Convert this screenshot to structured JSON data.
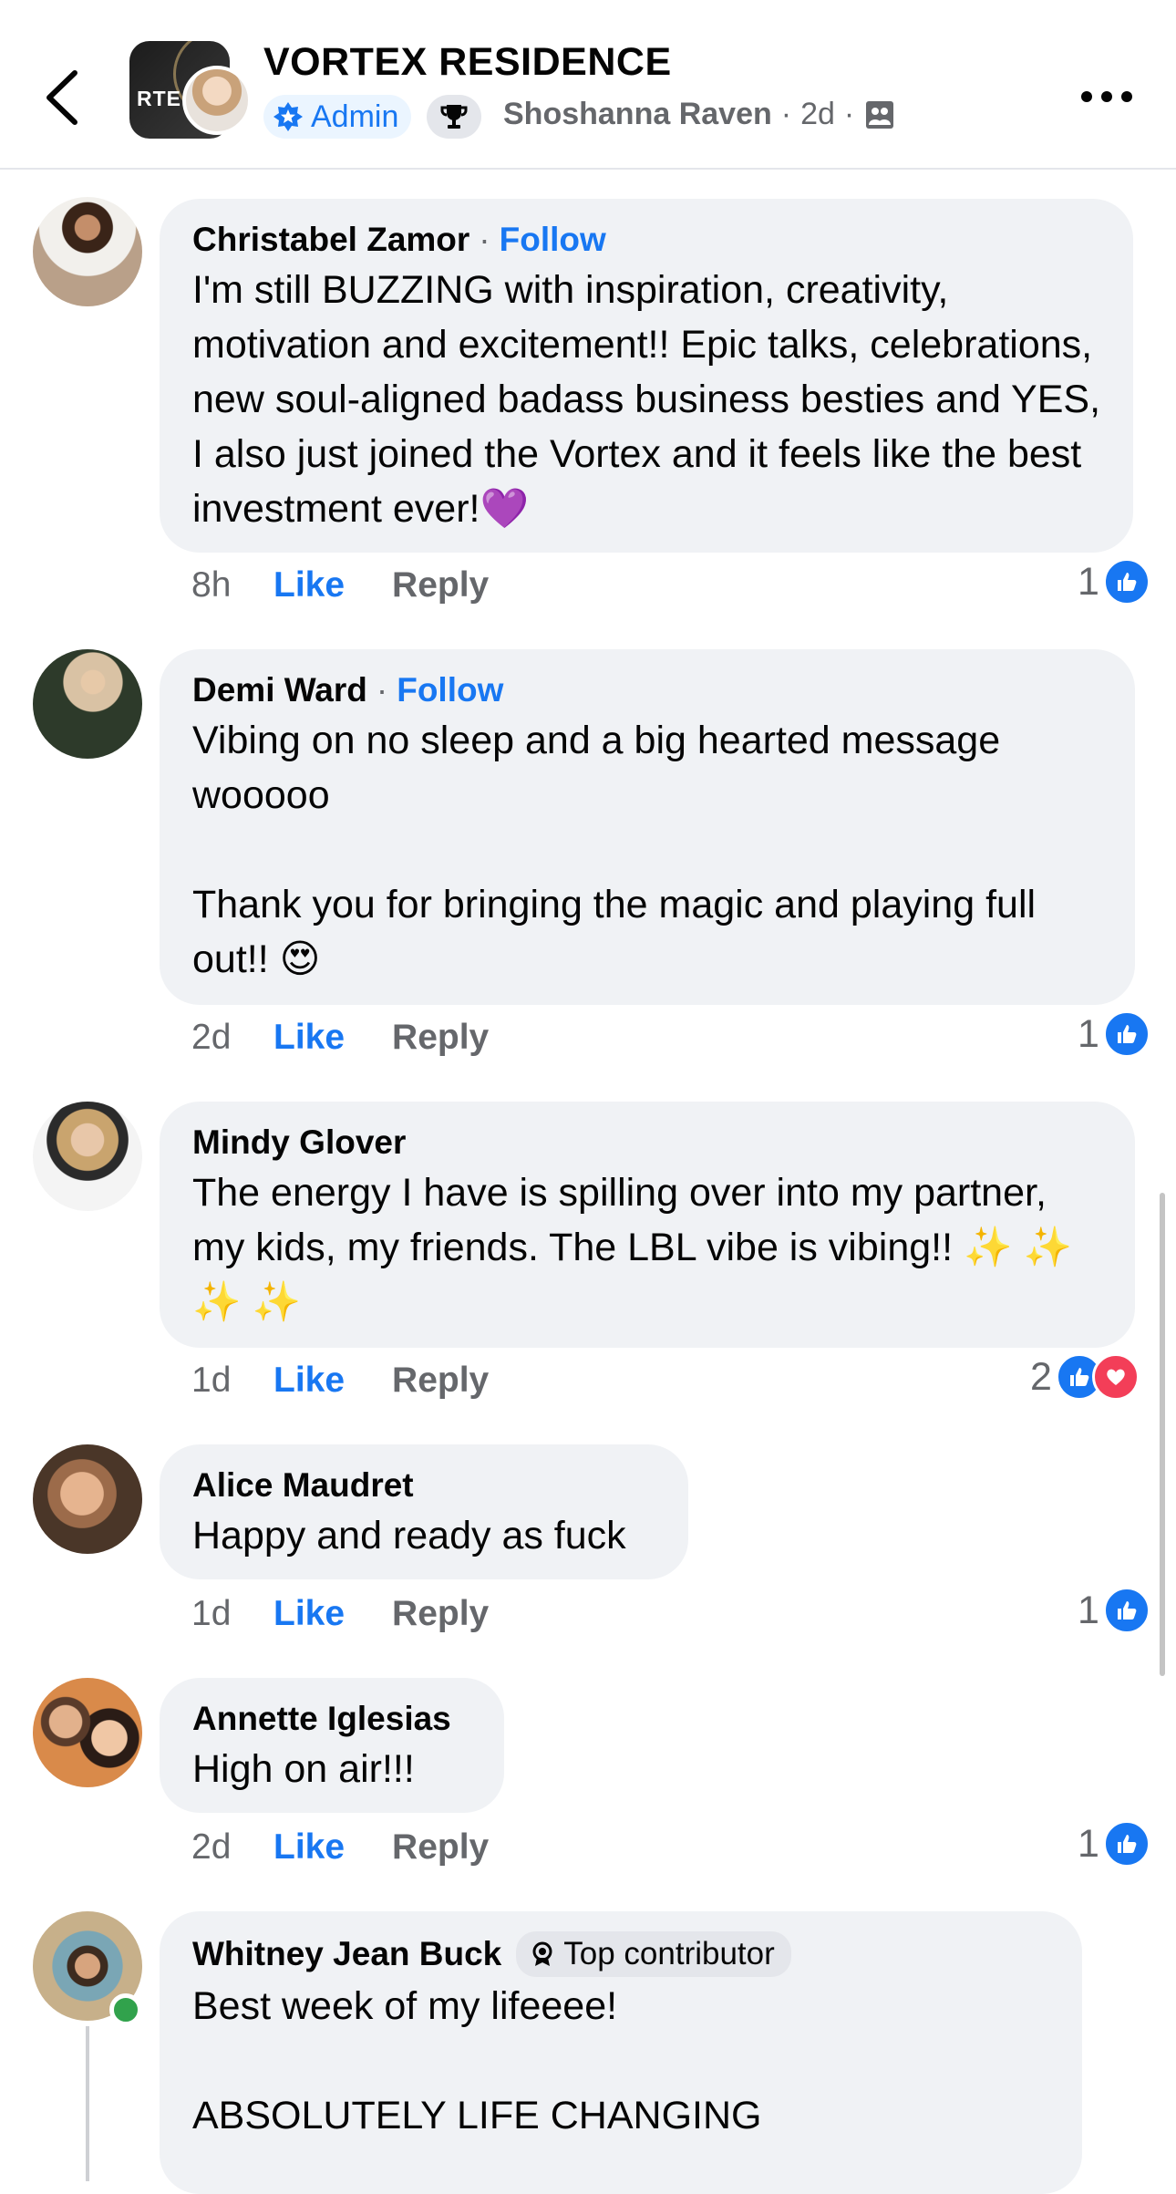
{
  "header": {
    "group_name": "VORTEX RESIDENCE",
    "group_avatar_text": "RTE",
    "role_badge": "Admin",
    "author": "Shoshanna Raven",
    "separator": "·",
    "time": "2d"
  },
  "comments": [
    {
      "author": "Christabel Zamor",
      "follow": "Follow",
      "text": "I'm still BUZZING with inspiration, creativity, motivation and excitement!! Epic talks, celebrations, new soul-aligned badass business besties and YES, I also just joined the Vortex and it feels like the best investment ever!💜",
      "time": "8h",
      "like": "Like",
      "reply": "Reply",
      "reaction_count": "1",
      "reactions": [
        "like"
      ]
    },
    {
      "author": "Demi Ward",
      "follow": "Follow",
      "text": "Vibing on no sleep and a big hearted message wooooo\n\nThank you for bringing the magic and playing full out!! 😍",
      "time": "2d",
      "like": "Like",
      "reply": "Reply",
      "reaction_count": "1",
      "reactions": [
        "like"
      ]
    },
    {
      "author": "Mindy Glover",
      "text": "The energy I have is spilling over into my partner, my kids, my friends. The LBL vibe is vibing!! ✨ ✨ ✨ ✨",
      "time": "1d",
      "like": "Like",
      "reply": "Reply",
      "reaction_count": "2",
      "reactions": [
        "like",
        "love"
      ]
    },
    {
      "author": "Alice Maudret",
      "text": "Happy and ready as fuck",
      "time": "1d",
      "like": "Like",
      "reply": "Reply",
      "reaction_count": "1",
      "reactions": [
        "like"
      ]
    },
    {
      "author": "Annette Iglesias",
      "text": "High on air!!!",
      "time": "2d",
      "like": "Like",
      "reply": "Reply",
      "reaction_count": "1",
      "reactions": [
        "like"
      ]
    },
    {
      "author": "Whitney Jean Buck",
      "badge": "Top contributor",
      "text": "Best week of my lifeeee!\n\nABSOLUTELY LIFE CHANGING"
    }
  ],
  "colors": {
    "accent": "#1877f2",
    "bubble": "#f0f2f5",
    "secondary_text": "#65676b",
    "love": "#f33e58",
    "online": "#31a24c"
  }
}
